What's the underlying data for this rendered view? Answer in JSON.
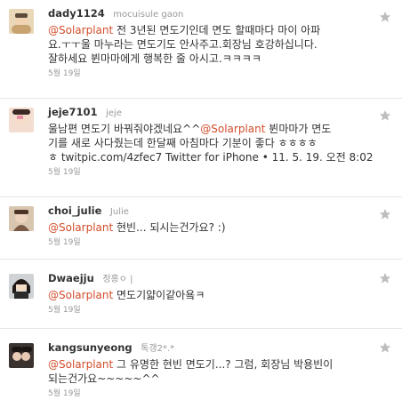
{
  "tweets": [
    {
      "screen_name": "dady1124",
      "full_name": "mocuisule gaon",
      "mention": "@Solarplant",
      "text_after_mention": " 전 3년된 면도기인데 면도 할때마다 마이 아파",
      "lines": [
        "요.ㅜㅜ울 마누라는 면도기도 안사주고.회장님 호강하십니다.",
        "잘하세요 뷘마마에게 행복한 줄 아시고.ㅋㅋㅋㅋ"
      ],
      "date": "5월 19일",
      "avatar_icon": "profile-photo"
    },
    {
      "screen_name": "jeje7101",
      "full_name": "jeje",
      "prefix": "울남편 면도기 바꿔줘야겠네요^^",
      "mention": "@Solarplant",
      "text_after_mention": " 뷘마마가 면도",
      "lines": [
        "기를 새로 사다줬는데 한달째 아침마다 기분이 좋다 ㅎㅎㅎㅎ",
        "ㅎ twitpic.com/4zfec7 Twitter for iPhone • 11. 5. 19. 오전 8:02"
      ],
      "date": "5월 19일",
      "avatar_icon": "profile-photo"
    },
    {
      "screen_name": "choi_julie",
      "full_name": "Julie",
      "mention": "@Solarplant",
      "text_after_mention": " 현빈... 되시는건가요? :)",
      "lines": [],
      "date": "5월 19일",
      "avatar_icon": "profile-photo"
    },
    {
      "screen_name": "Dwaejju",
      "full_name": "정홍ㅇ |",
      "mention": "@Solarplant",
      "text_after_mention": " 면도기얇이같아욬ㅋ",
      "lines": [],
      "date": "5월 19일",
      "avatar_icon": "profile-photo"
    },
    {
      "screen_name": "kangsunyeong",
      "full_name": "톡갱2*.*",
      "mention": "@Solarplant",
      "text_after_mention": " 그 유명한 현빈 면도기...? 그럼, 회장님 박용빈이",
      "lines": [
        "되는건가요~~~~~^^"
      ],
      "date": "5월 19일",
      "avatar_icon": "profile-photo"
    }
  ],
  "icons": {
    "favorite": "star-icon"
  },
  "colors": {
    "mention": "#d24d2c",
    "star": "#bdbdbd",
    "name": "#333333",
    "muted": "#999999"
  }
}
